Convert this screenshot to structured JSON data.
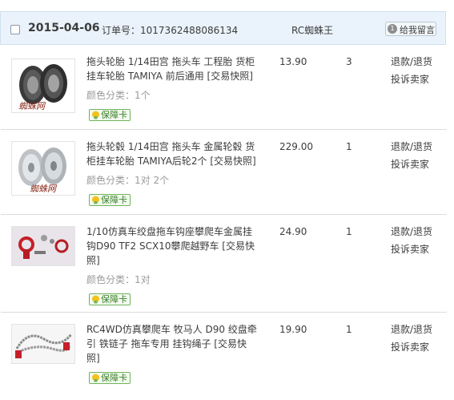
{
  "order": {
    "date": "2015-04-06",
    "order_number_label": "订单号：",
    "order_number": "1017362488086134",
    "seller": "RC蜘蛛王",
    "message_button": "给我留言",
    "message_count": "1"
  },
  "items": [
    {
      "title": "拖头轮胎 1/14田宫 拖头车 工程胎 货柜挂车轮胎 TAMIYA 前后通用 [交易快照]",
      "title_lines": [
        "拖头轮胎 1/14田宫 拖头车 工程胎 货柜",
        "挂车轮胎 TAMIYA 前后通用 [交易快照]"
      ],
      "attr": "颜色分类：1个",
      "badge": "保障卡",
      "price": "13.90",
      "qty": "3",
      "action1": "退款/退货",
      "action2": "投诉卖家",
      "watermark": "蜘蛛网"
    },
    {
      "title": "拖头轮毂 1/14田宫 拖头车 金属轮毂 货柜挂车轮胎 TAMIYA后轮2个 [交易快照]",
      "title_lines": [
        "拖头轮毂 1/14田宫 拖头车 金属轮毂 货",
        "柜挂车轮胎 TAMIYA后轮2个 [交易快照]"
      ],
      "attr": "颜色分类：1对 2个",
      "badge": "保障卡",
      "price": "229.00",
      "qty": "1",
      "action1": "退款/退货",
      "action2": "投诉卖家",
      "watermark": "蜘蛛网"
    },
    {
      "title": "1/10仿真车绞盘拖车钩座攀爬车金属挂钩D90 TF2 SCX10攀爬越野车 [交易快照]",
      "title_lines": [
        "1/10仿真车绞盘拖车钩座攀爬车金属挂",
        "钩D90 TF2 SCX10攀爬越野车 [交易快",
        "照]"
      ],
      "attr": "颜色分类：1对",
      "badge": "保障卡",
      "price": "24.90",
      "qty": "1",
      "action1": "退款/退货",
      "action2": "投诉卖家"
    },
    {
      "title": "RC4WD仿真攀爬车 牧马人 D90 绞盘牵引 铁链子 拖车专用 挂钩绳子 [交易快照]",
      "title_lines": [
        "RC4WD仿真攀爬车 牧马人 D90 绞盘牵",
        "引 铁链子 拖车专用 挂钩绳子 [交易快",
        "照]"
      ],
      "badge": "保障卡",
      "price": "19.90",
      "qty": "1",
      "action1": "退款/退货",
      "action2": "投诉卖家"
    }
  ],
  "colors": {
    "header_bg": "#eaf3fb",
    "badge_green": "#3b7f2b",
    "badge_icon": "#f2c21a"
  }
}
